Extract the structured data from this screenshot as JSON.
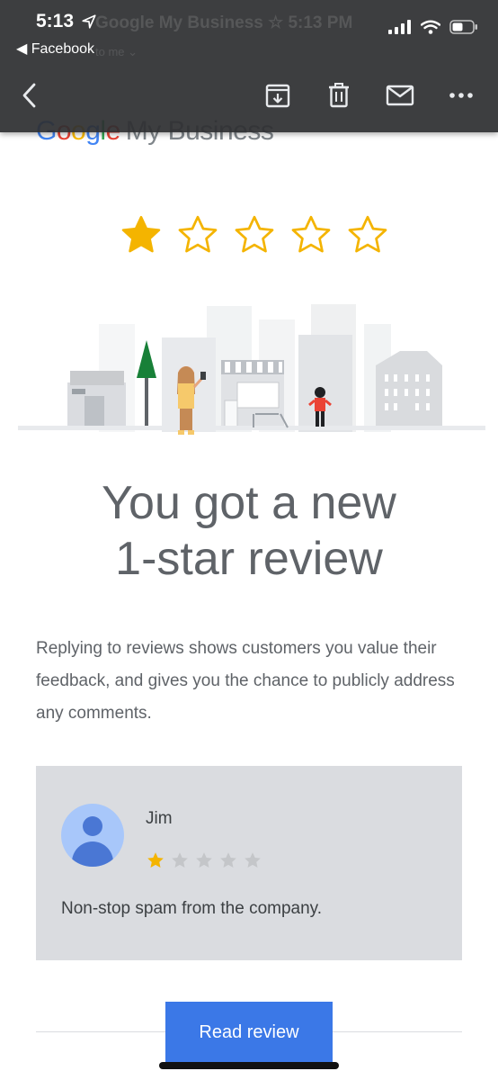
{
  "status_bar": {
    "time": "5:13",
    "back_app": "◀ Facebook"
  },
  "email_header": {
    "sender_ghost": "Google My Business ☆ 5:13 PM",
    "recipient_ghost": "to me ⌄"
  },
  "toolbar": {
    "icons": [
      "back-chevron-icon",
      "archive-icon",
      "trash-icon",
      "mail-icon",
      "more-icon"
    ]
  },
  "brand": {
    "google": [
      "G",
      "o",
      "o",
      "g",
      "l",
      "e"
    ],
    "product": "My Business"
  },
  "rating": {
    "stars_filled": 1,
    "stars_total": 5,
    "color": "#F4B400"
  },
  "headline": {
    "line1": "You got a new",
    "line2": "1-star review"
  },
  "body_text": "Replying to reviews shows customers you value their feedback, and gives you the chance to publicly address any comments.",
  "review": {
    "reviewer": "Jim",
    "stars_filled": 1,
    "stars_total": 5,
    "text": "Non-stop spam from the company."
  },
  "cta": {
    "label": "Read review",
    "color": "#3b78e7"
  }
}
